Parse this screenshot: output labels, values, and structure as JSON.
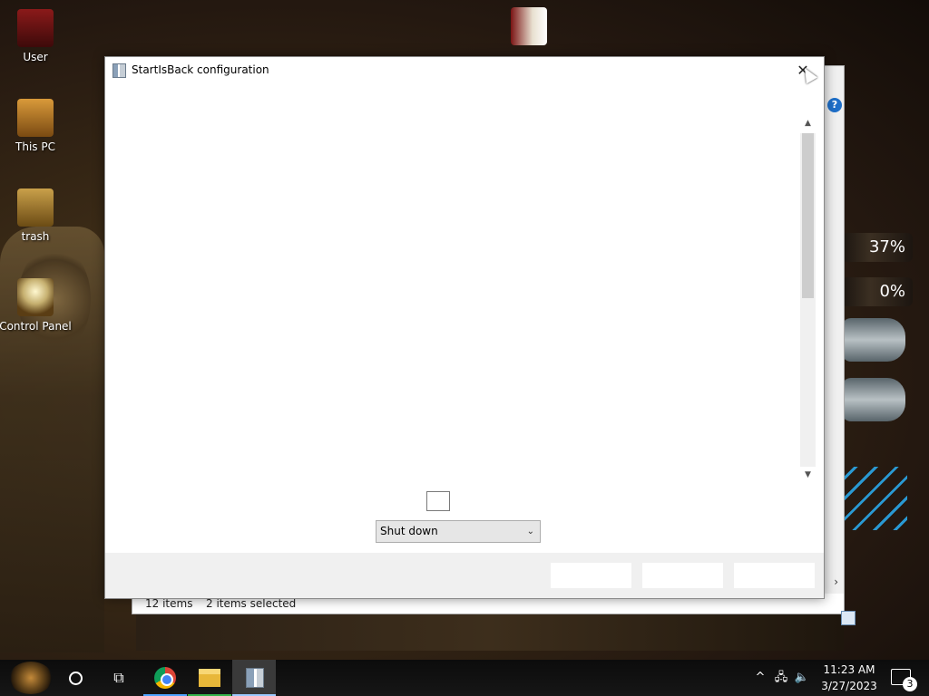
{
  "desktop": {
    "icons": [
      {
        "label": "User"
      },
      {
        "label": "This PC"
      },
      {
        "label": "trash"
      },
      {
        "label": "Control Panel"
      }
    ],
    "gauges": [
      "37%",
      "0%"
    ]
  },
  "explorer": {
    "status_items": "12 items",
    "status_selected": "2 items selected",
    "help_glyph": "?",
    "scroll_right_glyph": "›"
  },
  "dialog": {
    "title": "StartIsBack configuration",
    "close_glyph": "✕",
    "scroll_up_glyph": "▲",
    "scroll_down_glyph": "▼",
    "power_button_action": {
      "selected": "Shut down",
      "caret": "⌄"
    },
    "checkbox_checked": false
  },
  "taskbar": {
    "taskview_glyph": "⧉",
    "tray": {
      "chevron_glyph": "^",
      "network_glyph": "🖧",
      "volume_glyph": "🔈"
    },
    "clock": {
      "time": "11:23 AM",
      "date": "3/27/2023"
    },
    "notifications_count": "3",
    "accent_colors": {
      "chrome_underline": "#4da3ff",
      "files_underline": "#36b34a",
      "active_underline": "#9ccaff"
    }
  }
}
